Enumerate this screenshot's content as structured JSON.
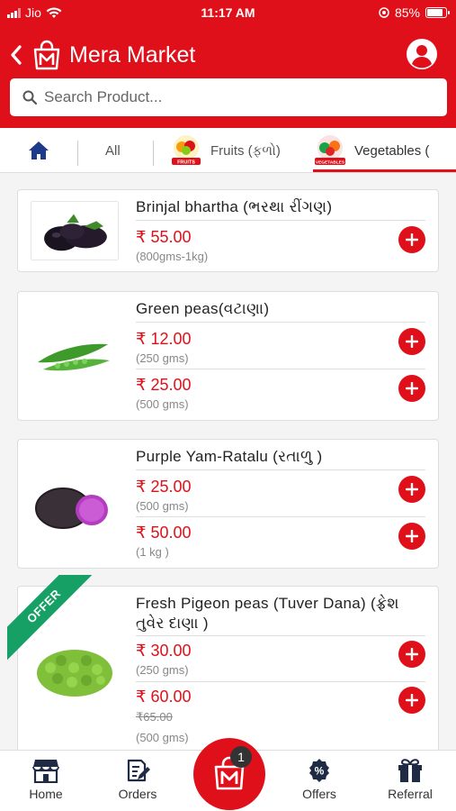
{
  "status_bar": {
    "carrier": "Jio",
    "time": "11:17 AM",
    "battery": "85%"
  },
  "header": {
    "title": "Mera Market"
  },
  "search": {
    "placeholder": "Search Product..."
  },
  "tabs": {
    "all": "All",
    "fruits": "Fruits (ફળો)",
    "fruits_badge": "FRUITS",
    "vegetables": "Vegetables (",
    "vegetables_badge": "VEGETABLES"
  },
  "products": [
    {
      "name": "Brinjal bhartha (ભરથા રીંગણ)",
      "variants": [
        {
          "price": "₹ 55.00",
          "qty": "(800gms-1kg)"
        }
      ]
    },
    {
      "name": "Green peas(વટાણા)",
      "variants": [
        {
          "price": "₹ 12.00",
          "qty": "(250 gms)"
        },
        {
          "price": "₹ 25.00",
          "qty": "(500 gms)"
        }
      ]
    },
    {
      "name": "Purple Yam-Ratalu (રતાળુ )",
      "variants": [
        {
          "price": "₹ 25.00",
          "qty": "(500 gms)"
        },
        {
          "price": "₹ 50.00",
          "qty": "(1 kg )"
        }
      ]
    },
    {
      "name": "Fresh Pigeon peas (Tuver Dana) (ફ્રેશ તુવેર દાણા )",
      "offer_label": "OFFER",
      "variants": [
        {
          "price": "₹ 30.00",
          "qty": "(250 gms)"
        },
        {
          "price": "₹ 60.00",
          "old_price": "₹65.00",
          "qty": "(500 gms)"
        }
      ]
    }
  ],
  "bottom_nav": {
    "home": "Home",
    "orders": "Orders",
    "cart_count": "1",
    "offers": "Offers",
    "referral": "Referral"
  },
  "colors": {
    "brand_red": "#e0101a",
    "offer_green": "#16a065"
  }
}
